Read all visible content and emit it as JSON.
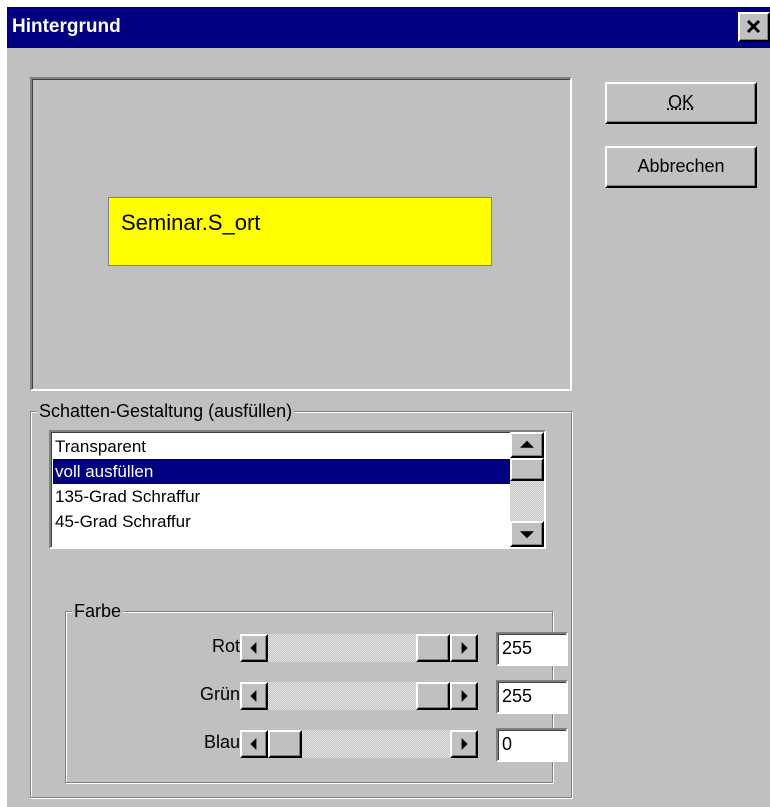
{
  "window": {
    "title": "Hintergrund"
  },
  "preview": {
    "text": "Seminar.S_ort",
    "fill_color": "#ffff00"
  },
  "buttons": {
    "ok": "OK",
    "cancel": "Abbrechen"
  },
  "shadow_group": {
    "legend": "Schatten-Gestaltung (ausfüllen)",
    "options": [
      "Transparent",
      "voll ausfüllen",
      "135-Grad Schraffur",
      "45-Grad Schraffur"
    ],
    "selected_index": 1
  },
  "color_group": {
    "legend": "Farbe",
    "sliders": [
      {
        "label": "Rot",
        "value": "255",
        "level": 1.0
      },
      {
        "label": "Grün",
        "value": "255",
        "level": 1.0
      },
      {
        "label": "Blau",
        "value": "0",
        "level": 0.0
      }
    ]
  },
  "colors": {
    "titlebar": "#000080",
    "dialog": "#c0c0c0",
    "selection": "#000080"
  }
}
